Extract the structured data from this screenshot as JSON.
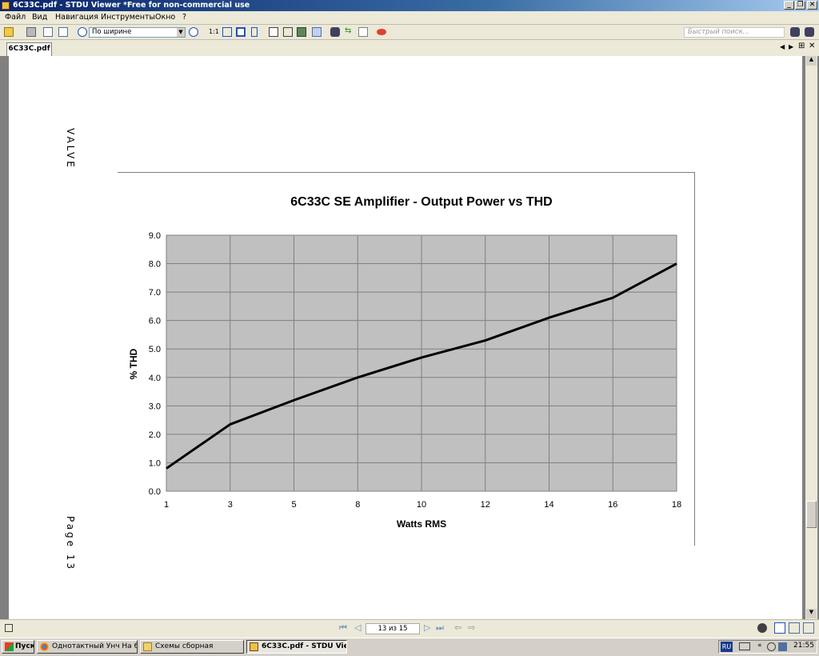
{
  "window": {
    "title": "6C33C.pdf - STDU Viewer *Free for non-commercial use",
    "minimize": "_",
    "restore": "❐",
    "close": "✕"
  },
  "menu": [
    "Файл",
    "Вид",
    "Навигация",
    "Инструменты",
    "Окно",
    "?"
  ],
  "toolbar": {
    "zoom_value": "По ширине",
    "actual_size": "1:1",
    "search_placeholder": "Быстрый поиск..."
  },
  "tab": {
    "label": "6C33C.pdf"
  },
  "document": {
    "side_left_top": "VALVE",
    "side_left_bottom": "Page 13"
  },
  "chart_data": {
    "type": "line",
    "title": "6C33C SE Amplifier - Output Power vs THD",
    "xlabel": "Watts RMS",
    "ylabel": "% THD",
    "categories": [
      "1",
      "3",
      "5",
      "8",
      "10",
      "12",
      "14",
      "16",
      "18"
    ],
    "values": [
      0.8,
      2.35,
      3.2,
      4.0,
      4.7,
      5.3,
      6.1,
      6.8,
      8.0
    ],
    "y_ticks": [
      "0.0",
      "1.0",
      "2.0",
      "3.0",
      "4.0",
      "5.0",
      "6.0",
      "7.0",
      "8.0",
      "9.0"
    ],
    "ylim": [
      0,
      9
    ],
    "grid": true,
    "plot_background": "#c0c0c0",
    "line_color": "#000000"
  },
  "status": {
    "page_indicator": "13 из 15"
  },
  "taskbar": {
    "start": "Пуск",
    "tasks": [
      "Однотактный Унч На 6...",
      "Схемы сборная",
      "6C33C.pdf - STDU Vie..."
    ],
    "language": "RU",
    "clock": "21:55"
  }
}
